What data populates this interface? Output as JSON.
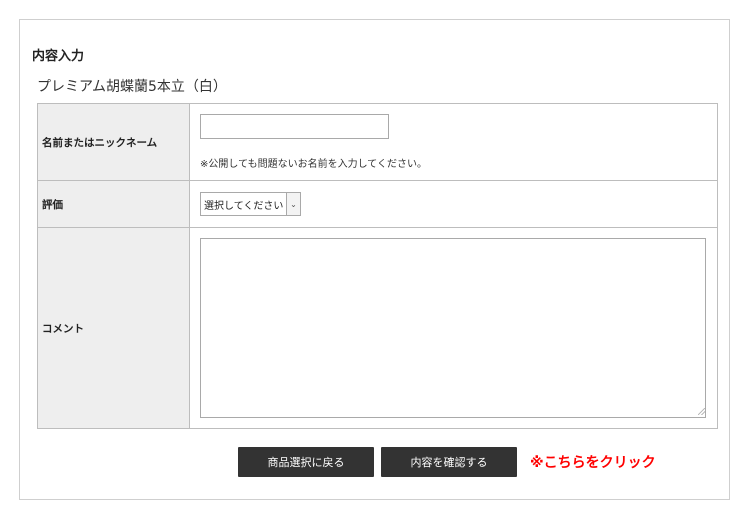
{
  "section": {
    "title": "内容入力"
  },
  "product": {
    "name": "プレミアム胡蝶蘭5本立（白）"
  },
  "form": {
    "name": {
      "label": "名前またはニックネーム",
      "value": "",
      "note": "※公開しても問題ないお名前を入力してください。"
    },
    "rating": {
      "label": "評価",
      "selected": "選択してください"
    },
    "comment": {
      "label": "コメント",
      "value": ""
    }
  },
  "buttons": {
    "back": "商品選択に戻る",
    "confirm": "内容を確認する"
  },
  "hint": {
    "text": "※こちらをクリック"
  },
  "colors": {
    "button_bg": "#333333",
    "hint": "#ff0000",
    "header_cell": "#eeeeee"
  }
}
